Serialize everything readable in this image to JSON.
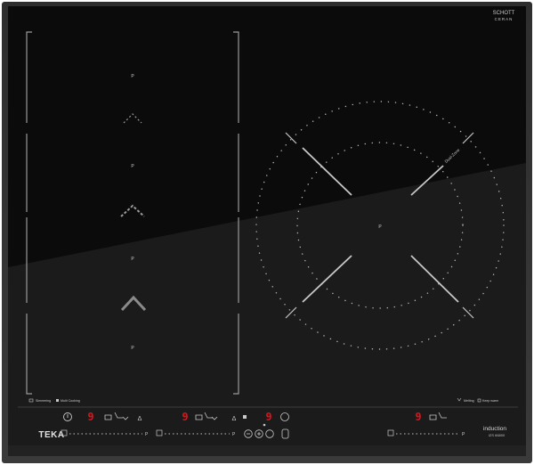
{
  "brand": {
    "maker": "TEKA",
    "glass_logo_top": "SCHOTT",
    "glass_logo_bottom": "CERAN",
    "tech_label": "induction",
    "model": "IZS 66800"
  },
  "cooking_zones": {
    "left_zone_markers": [
      "P",
      "P",
      "P",
      "P"
    ],
    "round_zone_marker": "P",
    "round_zone_label_text": "Dual-Zone"
  },
  "status_labels": {
    "left_1": "Simmering",
    "left_2": "Multi Cooking",
    "right_1": "Melting",
    "right_2": "Keep warm"
  },
  "control_panel": {
    "power_symbol": "Ⅰ",
    "left_zone_display": "9",
    "center_zone_1_display": "9",
    "center_zone_2_display": "9",
    "right_zone_display": "9",
    "left_slider_end": "P",
    "center_slider_end": "P",
    "right_slider_end": "P"
  },
  "colors": {
    "glass": "#0b0b0c",
    "glass_reflection": "#1b1b1c",
    "frame": "#303030",
    "print": "#c9c9c9",
    "display_red": "#e0121a"
  }
}
